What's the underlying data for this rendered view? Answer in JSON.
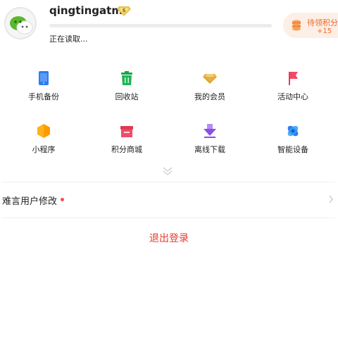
{
  "profile": {
    "username": "qingtingatm",
    "badge_icon": "vip-diamond-icon",
    "status": "正在读取...",
    "progress": 0
  },
  "points": {
    "label": "待领积分",
    "count": "+15",
    "icon": "coin-stack-icon",
    "color": "#f06a2a"
  },
  "grid": {
    "items": [
      {
        "label": "手机备份",
        "icon": "phone-backup-icon"
      },
      {
        "label": "回收站",
        "icon": "trash-bin-icon"
      },
      {
        "label": "我的会员",
        "icon": "diamond-icon"
      },
      {
        "label": "活动中心",
        "icon": "flag-icon"
      },
      {
        "label": "小程序",
        "icon": "mini-program-icon"
      },
      {
        "label": "积分商城",
        "icon": "points-mall-icon"
      },
      {
        "label": "离线下载",
        "icon": "offline-download-icon"
      },
      {
        "label": "智能设备",
        "icon": "smart-device-icon"
      }
    ],
    "expand_icon": "double-chevron-down-icon"
  },
  "settings_row": {
    "label": "难言用户修改",
    "indicator": "red-dot",
    "chevron": "chevron-right-icon"
  },
  "logout": {
    "label": "退出登录",
    "color": "#e8392c"
  }
}
